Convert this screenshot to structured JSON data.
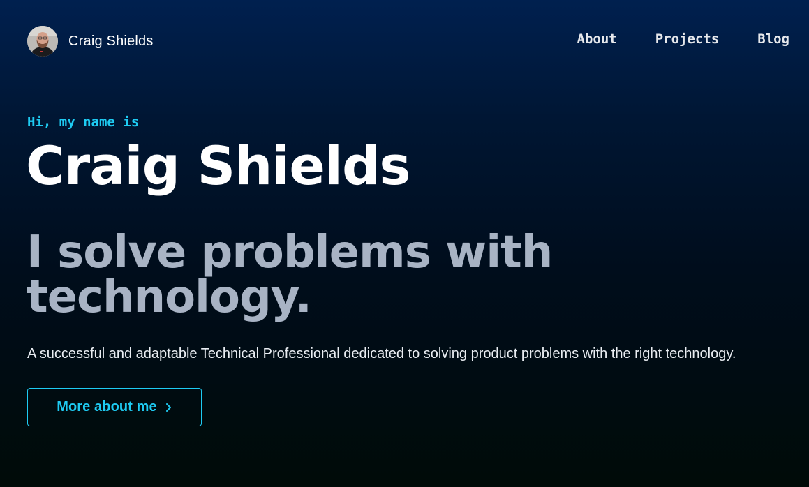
{
  "header": {
    "brand_name": "Craig Shields",
    "nav": [
      {
        "label": "About"
      },
      {
        "label": "Projects"
      },
      {
        "label": "Blog"
      }
    ]
  },
  "hero": {
    "intro": "Hi, my name is",
    "name": "Craig Shields",
    "tagline": "I solve problems with technology.",
    "summary": "A successful and adaptable Technical Professional dedicated to solving product problems with the right technology.",
    "cta_label": "More about me",
    "cta_icon": "chevron-right-icon"
  },
  "colors": {
    "accent": "#1ecbf2",
    "tagline": "#a8b3c4",
    "background_top": "#00204f",
    "background_bottom": "#000b08"
  }
}
